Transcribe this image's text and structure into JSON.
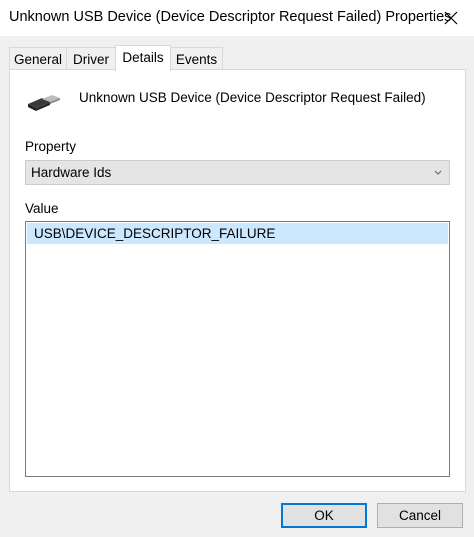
{
  "window": {
    "title": "Unknown USB Device (Device Descriptor Request Failed) Properties",
    "close_icon": "close-icon"
  },
  "tabs": [
    {
      "label": "General"
    },
    {
      "label": "Driver"
    },
    {
      "label": "Details",
      "active": true
    },
    {
      "label": "Events"
    }
  ],
  "device": {
    "icon": "usb-connector-icon",
    "name": "Unknown USB Device (Device Descriptor Request Failed)"
  },
  "property": {
    "label": "Property",
    "selected": "Hardware Ids"
  },
  "value": {
    "label": "Value",
    "items": [
      "USB\\DEVICE_DESCRIPTOR_FAILURE"
    ]
  },
  "buttons": {
    "ok": "OK",
    "cancel": "Cancel"
  },
  "colors": {
    "selection": "#cce8ff",
    "accent": "#0078d7"
  }
}
